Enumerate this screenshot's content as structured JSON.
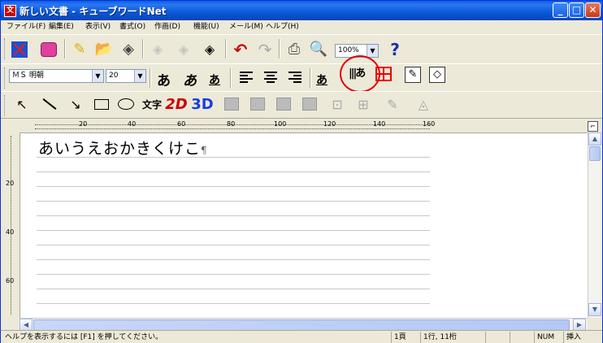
{
  "window": {
    "title": "新しい文書 - キューブワードNet",
    "app_icon": "文",
    "min_label": "_",
    "max_label": "□",
    "close_label": "✕"
  },
  "menu": [
    "ファイル(F)",
    "編集(E)",
    "表示(V)",
    "書式(O)",
    "作画(D)",
    "機能(U)",
    "メール(M)",
    "ヘルプ(H)"
  ],
  "toolbar1": {
    "zoom": "100%",
    "help_label": "?"
  },
  "toolbar2": {
    "font_name": "ＭＳ 明朝",
    "font_size": "20",
    "bold_label": "あ",
    "italic_label": "あ",
    "underline_label": "あ",
    "char_color_label": "あ",
    "vertical_label": "|||あ"
  },
  "toolbar3": {
    "text_label": "文字",
    "label_2d": "2D",
    "label_3d": "3D"
  },
  "ruler": {
    "ticks": [
      "20",
      "40",
      "60",
      "80",
      "100",
      "120",
      "140",
      "160"
    ],
    "vticks": [
      "20",
      "40",
      "60"
    ]
  },
  "document": {
    "text": "あいうえおかきくけこ",
    "pilcrow": "¶"
  },
  "status": {
    "help": "ヘルプを表示するには [F1] を押してください。",
    "page": "1頁",
    "position": "1行, 11桁",
    "num": "NUM",
    "insert": "挿入"
  },
  "colors": {
    "title_bar": "#0a58d8",
    "highlight_circle": "#e00000",
    "accent_3d": "#1a3ee0",
    "accent_2d": "#c00000"
  }
}
